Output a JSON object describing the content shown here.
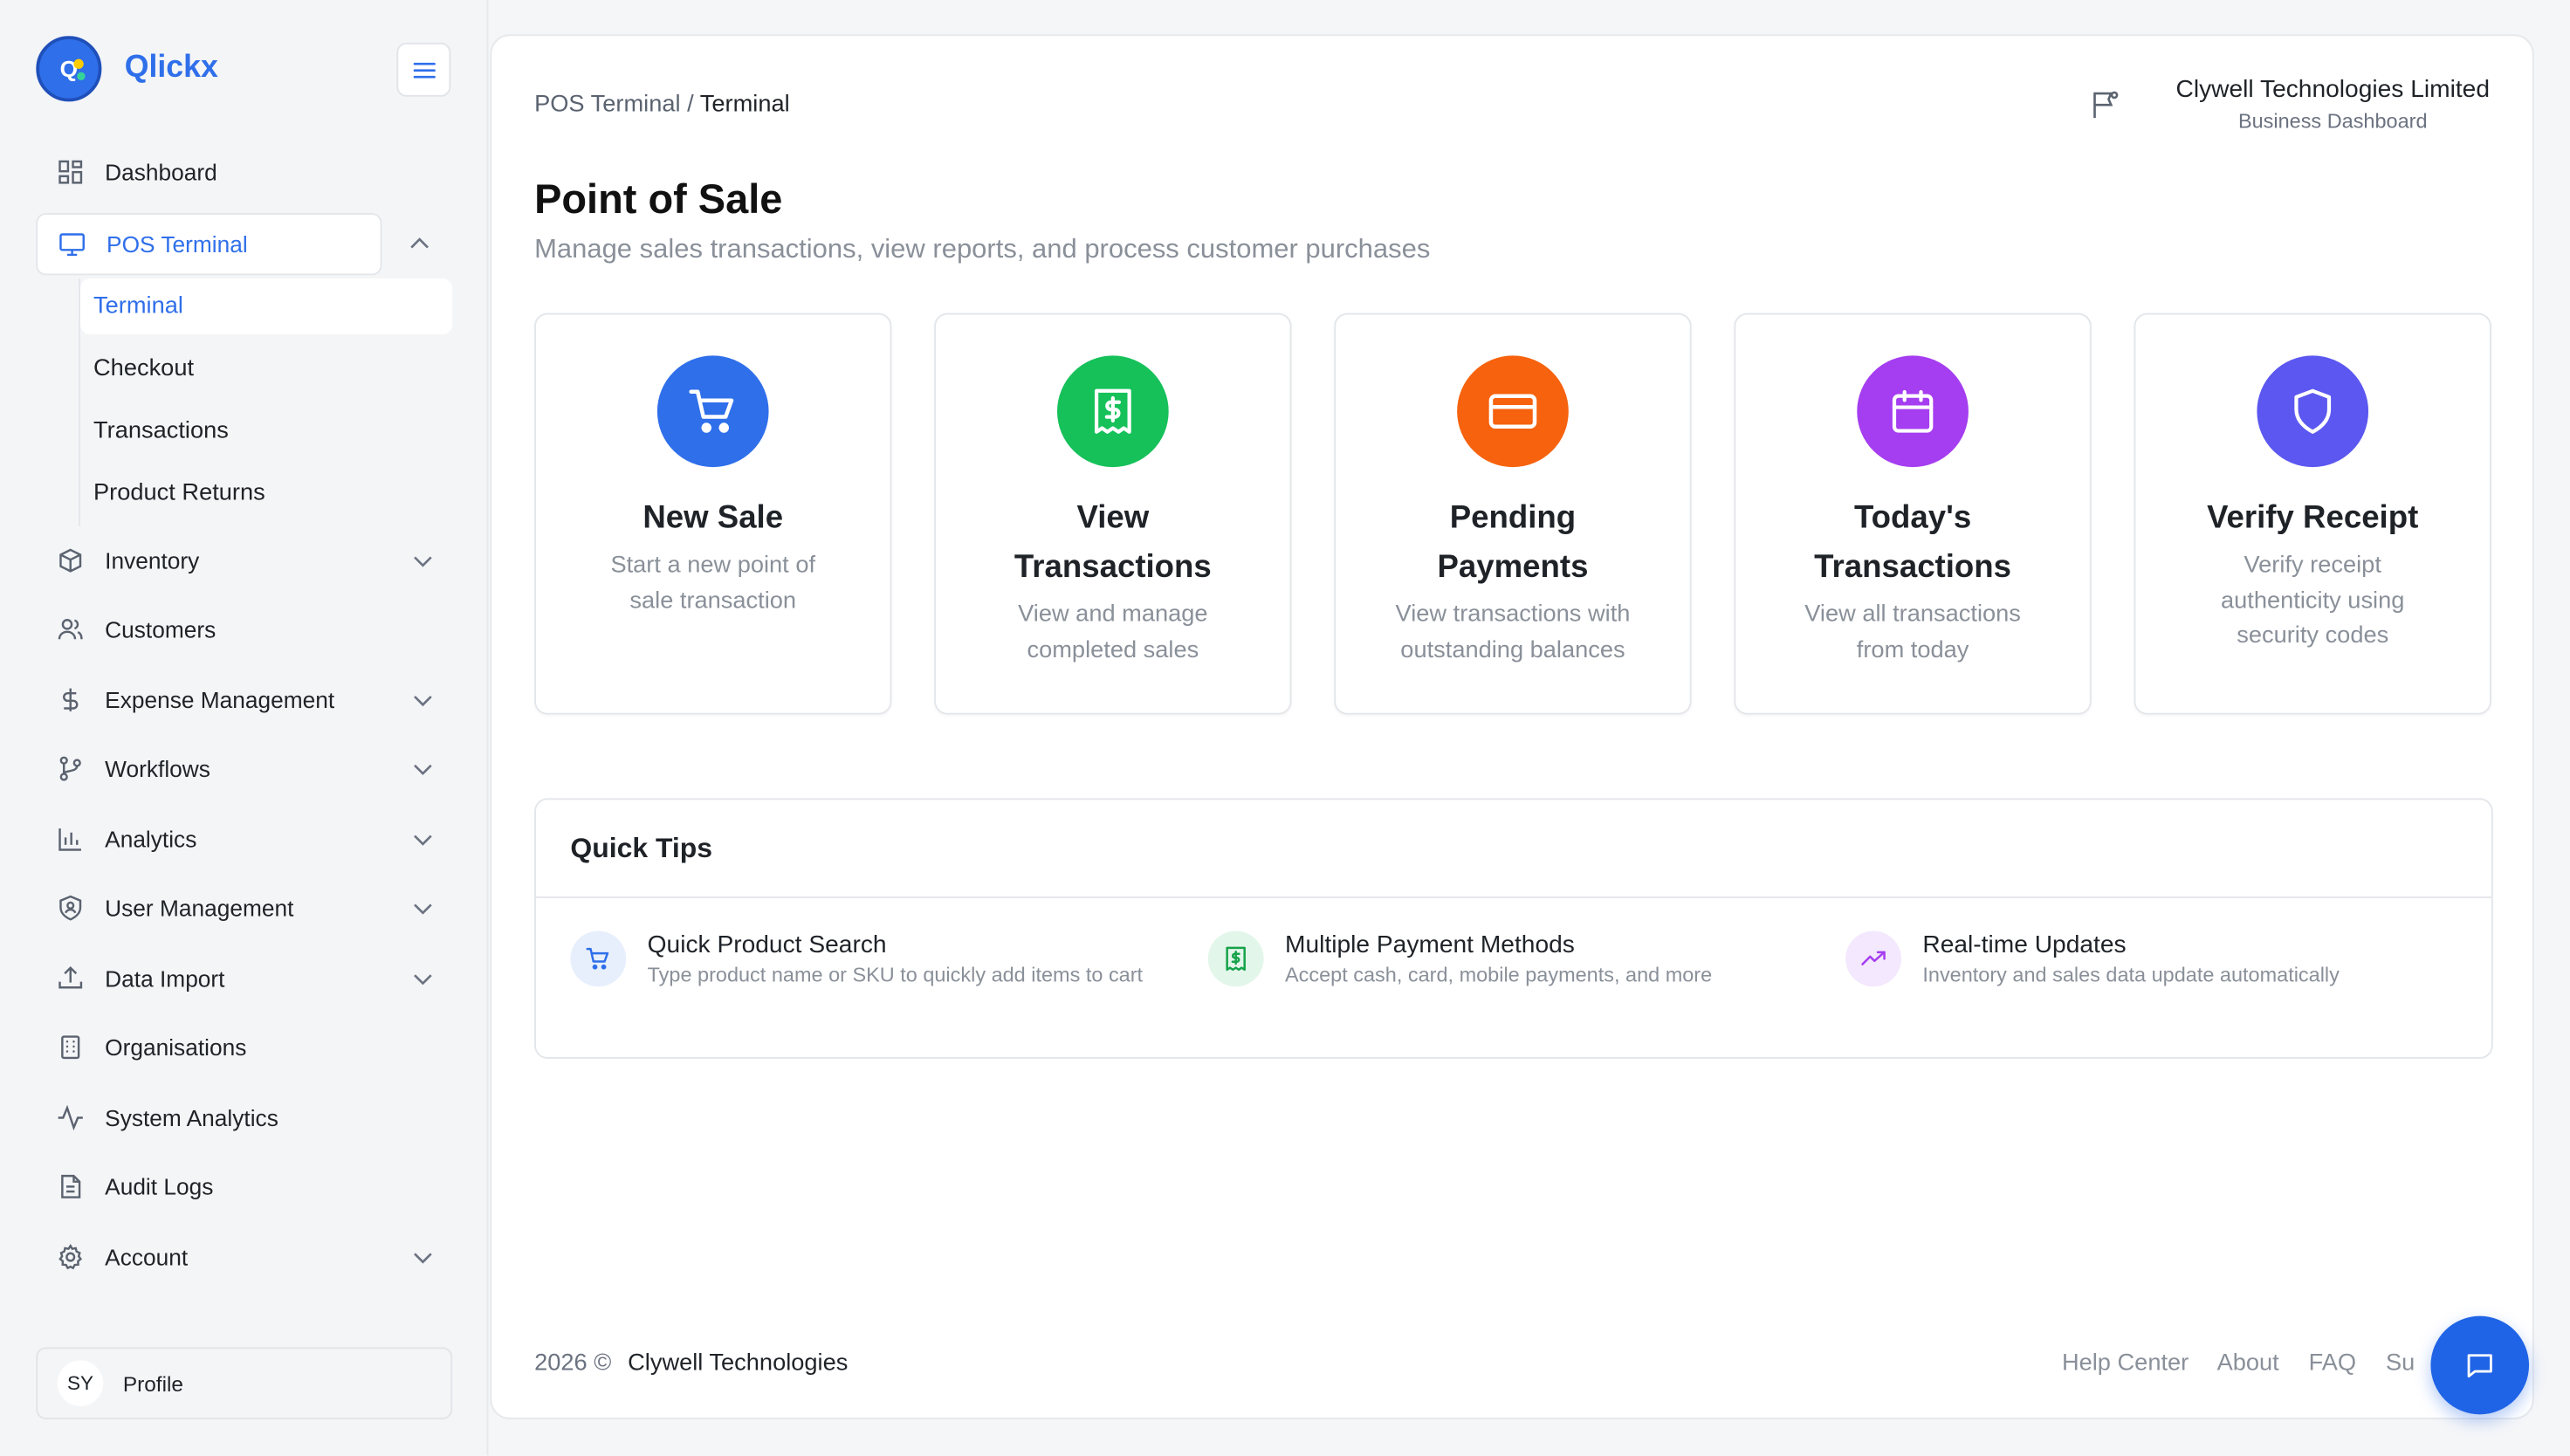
{
  "brand": {
    "name": "Qlickx",
    "logo_letter": "Q"
  },
  "sidebar": {
    "items": [
      {
        "key": "dashboard",
        "label": "Dashboard",
        "icon": "grid-icon",
        "chevron": false
      },
      {
        "key": "pos-terminal",
        "label": "POS Terminal",
        "icon": "monitor-icon",
        "chevron": "up",
        "active": true,
        "children": [
          "Terminal",
          "Checkout",
          "Transactions",
          "Product Returns"
        ],
        "active_child": "Terminal"
      },
      {
        "key": "inventory",
        "label": "Inventory",
        "icon": "package-icon",
        "chevron": "down"
      },
      {
        "key": "customers",
        "label": "Customers",
        "icon": "users-icon",
        "chevron": false
      },
      {
        "key": "expense-management",
        "label": "Expense Management",
        "icon": "dollar-icon",
        "chevron": "down"
      },
      {
        "key": "workflows",
        "label": "Workflows",
        "icon": "git-branch-icon",
        "chevron": "down"
      },
      {
        "key": "analytics",
        "label": "Analytics",
        "icon": "bar-chart-icon",
        "chevron": "down"
      },
      {
        "key": "user-management",
        "label": "User Management",
        "icon": "shield-user-icon",
        "chevron": "down"
      },
      {
        "key": "data-import",
        "label": "Data Import",
        "icon": "upload-icon",
        "chevron": "down"
      },
      {
        "key": "organisations",
        "label": "Organisations",
        "icon": "building-icon",
        "chevron": false
      },
      {
        "key": "system-analytics",
        "label": "System Analytics",
        "icon": "activity-icon",
        "chevron": false
      },
      {
        "key": "audit-logs",
        "label": "Audit Logs",
        "icon": "file-text-icon",
        "chevron": false
      },
      {
        "key": "account",
        "label": "Account",
        "icon": "gear-icon",
        "chevron": "down"
      }
    ],
    "profile": {
      "initials": "SY",
      "label": "Profile"
    }
  },
  "header": {
    "breadcrumb": {
      "parent": "POS Terminal",
      "separator": "/",
      "current": "Terminal"
    },
    "company": {
      "name": "Clywell Technologies Limited",
      "subtitle": "Business Dashboard"
    }
  },
  "page": {
    "title": "Point of Sale",
    "subtitle": "Manage sales transactions, view reports, and process customer purchases"
  },
  "cards": [
    {
      "title_lines": [
        "New Sale"
      ],
      "desc_lines": [
        "Start a new point of",
        "sale transaction"
      ],
      "color": "#2f6fea",
      "icon": "cart-icon"
    },
    {
      "title_lines": [
        "View",
        "Transactions"
      ],
      "desc_lines": [
        "View and manage",
        "completed sales"
      ],
      "color": "#16c15a",
      "icon": "receipt-icon"
    },
    {
      "title_lines": [
        "Pending",
        "Payments"
      ],
      "desc_lines": [
        "View transactions with",
        "outstanding balances"
      ],
      "color": "#f6620d",
      "icon": "credit-card-icon"
    },
    {
      "title_lines": [
        "Today's",
        "Transactions"
      ],
      "desc_lines": [
        "View all transactions",
        "from today"
      ],
      "color": "#a53df0",
      "icon": "calendar-icon"
    },
    {
      "title_lines": [
        "Verify Receipt"
      ],
      "desc_lines": [
        "Verify receipt",
        "authenticity using",
        "security codes"
      ],
      "color": "#5b57f0",
      "icon": "shield-icon"
    }
  ],
  "tips": {
    "heading": "Quick Tips",
    "items": [
      {
        "title": "Quick Product Search",
        "desc": "Type product name or SKU to quickly add items to cart",
        "icon": "cart-icon",
        "color": "#2f6fea",
        "bg": "#e8effc"
      },
      {
        "title": "Multiple Payment Methods",
        "desc": "Accept cash, card, mobile payments, and more",
        "icon": "receipt-icon",
        "color": "#16a34a",
        "bg": "#e3f6ea"
      },
      {
        "title": "Real-time Updates",
        "desc": "Inventory and sales data update automatically",
        "icon": "trending-up-icon",
        "color": "#a53df0",
        "bg": "#f3e8fd"
      }
    ]
  },
  "footer": {
    "year": "2026",
    "copyright": "©",
    "org": "Clywell Technologies",
    "links": [
      "Help Center",
      "About",
      "FAQ",
      "Support"
    ]
  }
}
